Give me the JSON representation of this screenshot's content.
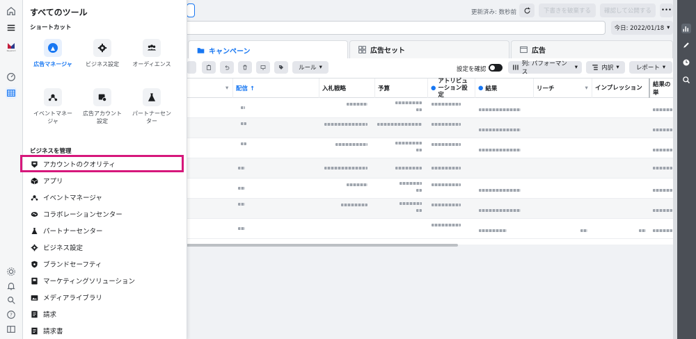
{
  "header": {
    "updated_text": "更新済み: 数秒前",
    "discard_label": "下書きを破棄する",
    "review_label": "確認して公開する",
    "more_label": "•••"
  },
  "date": {
    "label": "今日: 2022/01/18"
  },
  "tabs": [
    {
      "label": "キャンペーン"
    },
    {
      "label": "広告セット"
    },
    {
      "label": "広告"
    }
  ],
  "toolbar": {
    "rules_label": "ルール",
    "show_settings_label": "設定を確認",
    "columns_label": "列: パフォーマンス",
    "breakdown_label": "内訳",
    "reports_label": "レポート"
  },
  "table": {
    "columns": [
      "配信 ↑",
      "入札戦略",
      "予算",
      "アトリビューション設定",
      "結果",
      "リーチ",
      "インプレッション",
      "結果の単"
    ]
  },
  "panel": {
    "title": "すべてのツール",
    "shortcuts_label": "ショートカット",
    "shortcuts": [
      {
        "label": "広告マネージャ",
        "icon": "ads-manager-icon"
      },
      {
        "label": "ビジネス設定",
        "icon": "gear-icon"
      },
      {
        "label": "オーディエンス",
        "icon": "audience-icon"
      },
      {
        "label": "イベントマネージャ",
        "icon": "events-icon"
      },
      {
        "label": "広告アカウント設定",
        "icon": "account-settings-icon"
      },
      {
        "label": "パートナーセンター",
        "icon": "flask-icon"
      }
    ],
    "manage_label": "ビジネスを管理",
    "menu": [
      {
        "label": "アカウントのクオリティ",
        "icon": "shield-check-icon"
      },
      {
        "label": "アプリ",
        "icon": "cube-icon"
      },
      {
        "label": "イベントマネージャ",
        "icon": "events-icon"
      },
      {
        "label": "コラボレーションセンター",
        "icon": "handshake-icon"
      },
      {
        "label": "パートナーセンター",
        "icon": "flask-icon"
      },
      {
        "label": "ビジネス設定",
        "icon": "gear-icon"
      },
      {
        "label": "ブランドセーフティ",
        "icon": "shield-icon"
      },
      {
        "label": "マーケティングソリューション",
        "icon": "book-icon"
      },
      {
        "label": "メディアライブラリ",
        "icon": "media-icon"
      },
      {
        "label": "請求",
        "icon": "billing-icon"
      },
      {
        "label": "請求書",
        "icon": "invoice-icon"
      }
    ]
  },
  "colors": {
    "accent": "#1877f2",
    "highlight": "#d6177b"
  }
}
